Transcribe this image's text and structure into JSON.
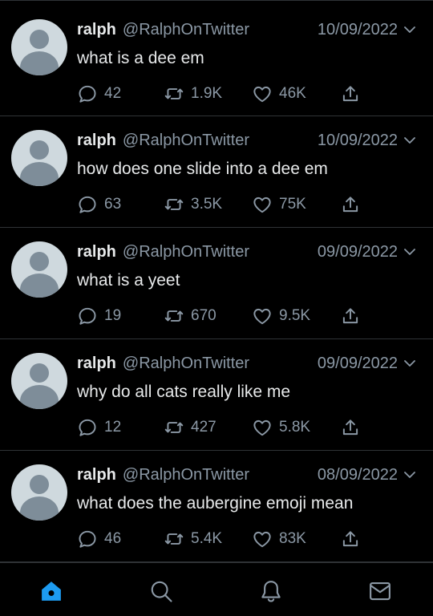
{
  "tweets": [
    {
      "name": "ralph",
      "handle": "@RalphOnTwitter",
      "date": "10/09/2022",
      "text": "what is a dee em",
      "replies": "42",
      "retweets": "1.9K",
      "likes": "46K"
    },
    {
      "name": "ralph",
      "handle": "@RalphOnTwitter",
      "date": "10/09/2022",
      "text": "how does one slide into a dee em",
      "replies": "63",
      "retweets": "3.5K",
      "likes": "75K"
    },
    {
      "name": "ralph",
      "handle": "@RalphOnTwitter",
      "date": "09/09/2022",
      "text": "what is a yeet",
      "replies": "19",
      "retweets": "670",
      "likes": "9.5K"
    },
    {
      "name": "ralph",
      "handle": "@RalphOnTwitter",
      "date": "09/09/2022",
      "text": "why do all cats really like me",
      "replies": "12",
      "retweets": "427",
      "likes": "5.8K"
    },
    {
      "name": "ralph",
      "handle": "@RalphOnTwitter",
      "date": "08/09/2022",
      "text": "what does the aubergine emoji mean",
      "replies": "46",
      "retweets": "5.4K",
      "likes": "83K"
    }
  ],
  "tabbar": {
    "items": [
      {
        "icon": "home-icon",
        "active": true
      },
      {
        "icon": "search-icon",
        "active": false
      },
      {
        "icon": "bell-icon",
        "active": false
      },
      {
        "icon": "mail-icon",
        "active": false
      }
    ]
  },
  "colors": {
    "background": "#000000",
    "text": "#e7e9ea",
    "muted": "#8b98a5",
    "accent": "#1d9bf0",
    "divider": "#2f3336"
  }
}
